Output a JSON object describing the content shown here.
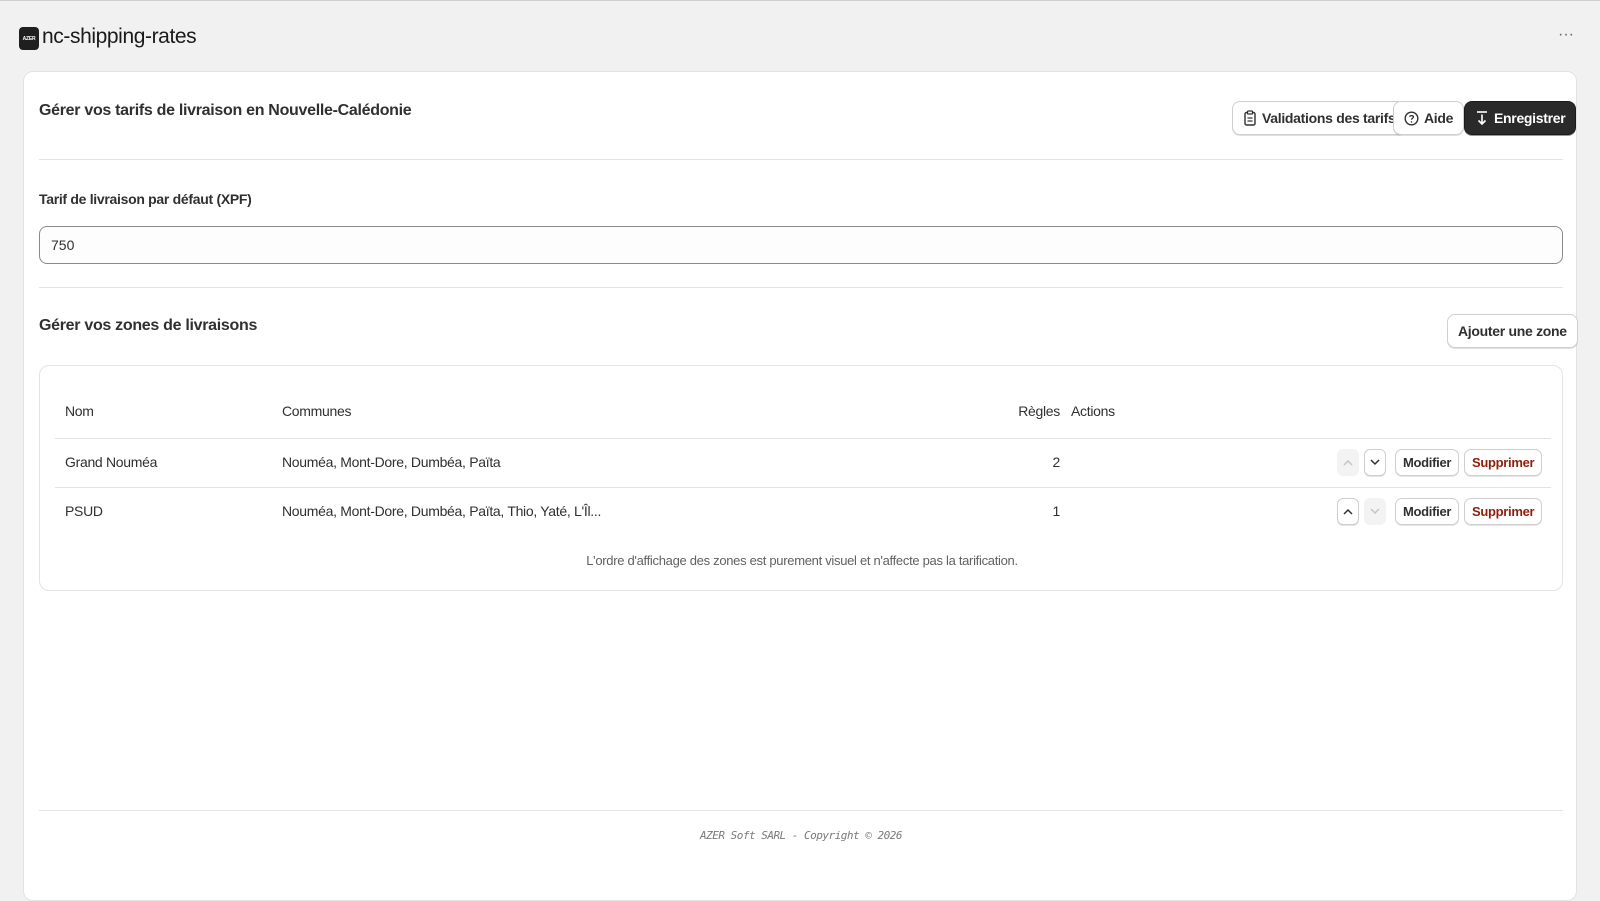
{
  "app": {
    "logo_text": "AZER",
    "title": "nc-shipping-rates",
    "more_label": "···"
  },
  "header": {
    "title": "Gérer vos tarifs de livraison en Nouvelle-Calédonie",
    "validate_button": "Validations des tarifs",
    "help_button": "Aide",
    "save_button": "Enregistrer"
  },
  "default_rate": {
    "label": "Tarif de livraison par défaut (XPF)",
    "value": "750"
  },
  "zones": {
    "title": "Gérer vos zones de livraisons",
    "add_button": "Ajouter une zone",
    "columns": {
      "name": "Nom",
      "communes": "Communes",
      "rules": "Règles",
      "actions": "Actions"
    },
    "rows": [
      {
        "name": "Grand Nouméa",
        "communes": "Nouméa, Mont-Dore, Dumbéa, Païta",
        "rules": "2",
        "edit": "Modifier",
        "delete": "Supprimer"
      },
      {
        "name": "PSUD",
        "communes": "Nouméa, Mont-Dore, Dumbéa, Païta, Thio, Yaté, L'Îl...",
        "rules": "1",
        "edit": "Modifier",
        "delete": "Supprimer"
      }
    ],
    "footnote": "L'ordre d'affichage des zones est purement visuel et n'affecte pas la tarification."
  },
  "footer": {
    "copyright": "AZER Soft SARL - Copyright © 2026"
  },
  "colors": {
    "primary_button": "#2a2a2a",
    "danger_text": "#8e1f0b",
    "page_background": "#f1f1f1"
  }
}
